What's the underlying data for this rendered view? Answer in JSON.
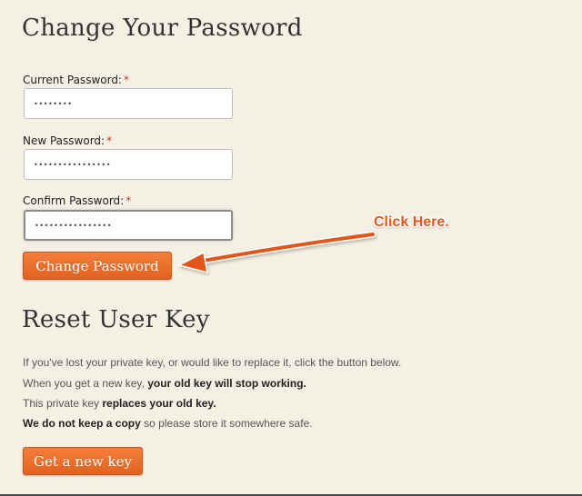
{
  "change_password": {
    "title": "Change Your Password",
    "fields": [
      {
        "label": "Current Password:",
        "required_mark": "*",
        "value": "••••••••"
      },
      {
        "label": "New Password:",
        "required_mark": "*",
        "value": "••••••••••••••••"
      },
      {
        "label": "Confirm Password:",
        "required_mark": "*",
        "value": "••••••••••••••••"
      }
    ],
    "submit_label": "Change Password"
  },
  "annotation": {
    "text": "Click Here.",
    "color": "#e2571e"
  },
  "reset_key": {
    "title": "Reset User Key",
    "lines": [
      {
        "pre": "If you've lost your private key, or would like to replace it, click the button below.",
        "bold": "",
        "post": ""
      },
      {
        "pre": "When you get a new key, ",
        "bold": "your old key will stop working.",
        "post": ""
      },
      {
        "pre": "This private key ",
        "bold": "replaces your old key.",
        "post": ""
      },
      {
        "pre": "",
        "bold": "We do not keep a copy",
        "post": " so please store it somewhere safe."
      }
    ],
    "button_label": "Get a new key"
  },
  "colors": {
    "background": "#f4f1e4",
    "accent": "#e8682a"
  }
}
